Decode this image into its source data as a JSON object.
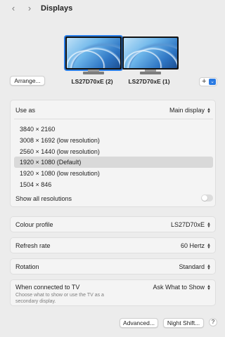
{
  "header": {
    "title": "Displays",
    "back_glyph": "‹",
    "forward_glyph": "›"
  },
  "arrange_button": "Arrange...",
  "displays": [
    {
      "name": "LS27D70xE (2)",
      "selected": true
    },
    {
      "name": "LS27D70xE (1)",
      "selected": false
    }
  ],
  "add_button": {
    "plus": "+",
    "chevron": "⌄"
  },
  "use_as": {
    "label": "Use as",
    "value": "Main display"
  },
  "resolutions": [
    {
      "label": "3840 × 2160",
      "selected": false
    },
    {
      "label": "3008 × 1692 (low resolution)",
      "selected": false
    },
    {
      "label": "2560 × 1440 (low resolution)",
      "selected": false
    },
    {
      "label": "1920 × 1080 (Default)",
      "selected": true
    },
    {
      "label": "1920 × 1080 (low resolution)",
      "selected": false
    },
    {
      "label": "1504 × 846",
      "selected": false
    }
  ],
  "show_all": {
    "label": "Show all resolutions",
    "on": false
  },
  "colour_profile": {
    "label": "Colour profile",
    "value": "LS27D70xE"
  },
  "refresh_rate": {
    "label": "Refresh rate",
    "value": "60 Hertz"
  },
  "rotation": {
    "label": "Rotation",
    "value": "Standard"
  },
  "when_connected": {
    "label": "When connected to TV",
    "subtitle": "Choose what to show or use the TV as a secondary display.",
    "value": "Ask What to Show"
  },
  "footer": {
    "advanced": "Advanced...",
    "night_shift": "Night Shift...",
    "help": "?"
  },
  "colors": {
    "accent": "#2a7ae2",
    "selection": "#d9d9d9",
    "background": "#ececec"
  }
}
